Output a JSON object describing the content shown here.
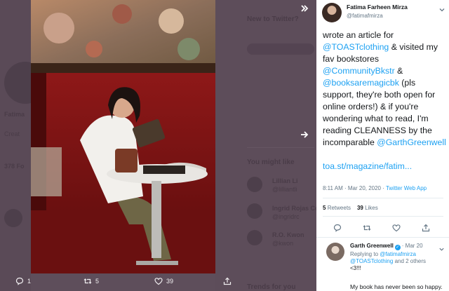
{
  "background": {
    "section_title": "New to Twitter?",
    "who_to_follow": "You might like",
    "trends": "Trends for you",
    "profile_name": "Fatima",
    "profile_sub": "Creat",
    "profile_stats": "378 Fo",
    "list": [
      {
        "name": "Lillian Li",
        "handle": "@lilliantli"
      },
      {
        "name": "Ingrid Rojas Co",
        "handle": "@ingridrc"
      },
      {
        "name": "R.O. Kwon",
        "handle": "@kwon"
      }
    ]
  },
  "actions": {
    "reply_count": "1",
    "retweet_count": "5",
    "like_count": "39"
  },
  "tweet": {
    "author_name": "Fatima Farheen Mirza",
    "author_handle": "@fatimafmirza",
    "text_parts": [
      {
        "t": "wrote an article for ",
        "m": false
      },
      {
        "t": "@TOASTclothing",
        "m": true
      },
      {
        "t": " & visited my fav bookstores ",
        "m": false
      },
      {
        "t": "@CommunityBkstr",
        "m": true
      },
      {
        "t": " & ",
        "m": false
      },
      {
        "t": "@booksaremagicbk",
        "m": true
      },
      {
        "t": " (pls support, they're both open for online orders!) & if you're wondering what to read, I'm reading CLEANNESS by the incomparable ",
        "m": false
      },
      {
        "t": "@GarthGreenwell",
        "m": true
      }
    ],
    "link": "toa.st/magazine/fatim...",
    "time": "8:11 AM · Mar 20, 2020 · ",
    "app": "Twitter Web App",
    "retweets": "5",
    "retweets_label": "Retweets",
    "likes": "39",
    "likes_label": "Likes"
  },
  "reply": {
    "name": "Garth Greenwell",
    "verified_glyph": "✓",
    "date": "· Mar 20",
    "replying_prefix": "Replying to ",
    "replying_to": "@fatimafmirza",
    "replying_more": "@TOASTclothing",
    "replying_suffix": " and 2 others",
    "replying_end": "<3!!!",
    "text": "My book has never been so happy."
  },
  "colors": {
    "link": "#1da1f2",
    "overlay_bg": "#5e4e5b"
  }
}
